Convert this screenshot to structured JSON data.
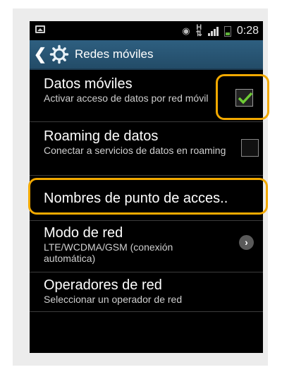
{
  "status_bar": {
    "time": "0:28",
    "eye_icon": "eye-icon",
    "network_label": "H",
    "battery_color": "#5fb33a"
  },
  "action_bar": {
    "title": "Redes móviles",
    "background": "#2e5f80"
  },
  "settings": [
    {
      "title": "Datos móviles",
      "subtitle": "Activar acceso de datos por red móvil",
      "control": "checkbox",
      "checked": true
    },
    {
      "title": "Roaming de datos",
      "subtitle": "Conectar a servicios de datos en roaming",
      "control": "checkbox",
      "checked": false
    },
    {
      "title": "Nombres de punto de acces..",
      "subtitle": ""
    },
    {
      "title": "Modo de red",
      "subtitle": "LTE/WCDMA/GSM (conexión automática)",
      "control": "chevron"
    },
    {
      "title": "Operadores de red",
      "subtitle": "Seleccionar un operador de red"
    }
  ],
  "highlight_color": "#f2a900",
  "check_color": "#6ecb35"
}
